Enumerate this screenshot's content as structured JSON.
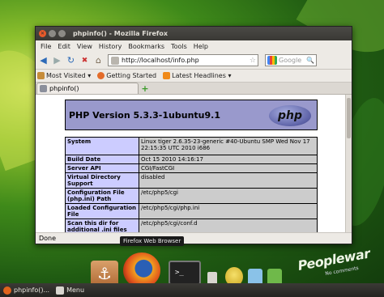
{
  "window": {
    "title": "phpinfo() - Mozilla Firefox"
  },
  "menu": [
    "File",
    "Edit",
    "View",
    "History",
    "Bookmarks",
    "Tools",
    "Help"
  ],
  "address": {
    "url": "http://localhost/info.php",
    "search_placeholder": "Google"
  },
  "bookmarks": [
    "Most Visited ▾",
    "Getting Started",
    "Latest Headlines ▾"
  ],
  "tab": {
    "label": "phpinfo()"
  },
  "page": {
    "heading": "PHP Version 5.3.3-1ubuntu9.1",
    "logo_text": "php",
    "rows": [
      {
        "key": "System",
        "value": "Linux tiger 2.6.35-23-generic #40-Ubuntu SMP Wed Nov 17 22:15:35 UTC 2010 i686"
      },
      {
        "key": "Build Date",
        "value": "Oct 15 2010 14:16:17"
      },
      {
        "key": "Server API",
        "value": "CGI/FastCGI"
      },
      {
        "key": "Virtual Directory Support",
        "value": "disabled"
      },
      {
        "key": "Configuration File (php.ini) Path",
        "value": "/etc/php5/cgi"
      },
      {
        "key": "Loaded Configuration File",
        "value": "/etc/php5/cgi/php.ini"
      },
      {
        "key": "Scan this dir for additional .ini files",
        "value": "/etc/php5/cgi/conf.d"
      }
    ]
  },
  "status": "Done",
  "tooltip": "Firefox Web Browser",
  "brand": {
    "main": "Peoplewar",
    "sub": "No comments"
  },
  "panel": {
    "task": "phpinfo()...",
    "menu": "Menu"
  },
  "colors": {
    "php_header": "#9999cc",
    "php_key": "#ccccff",
    "php_value": "#cccccc"
  }
}
